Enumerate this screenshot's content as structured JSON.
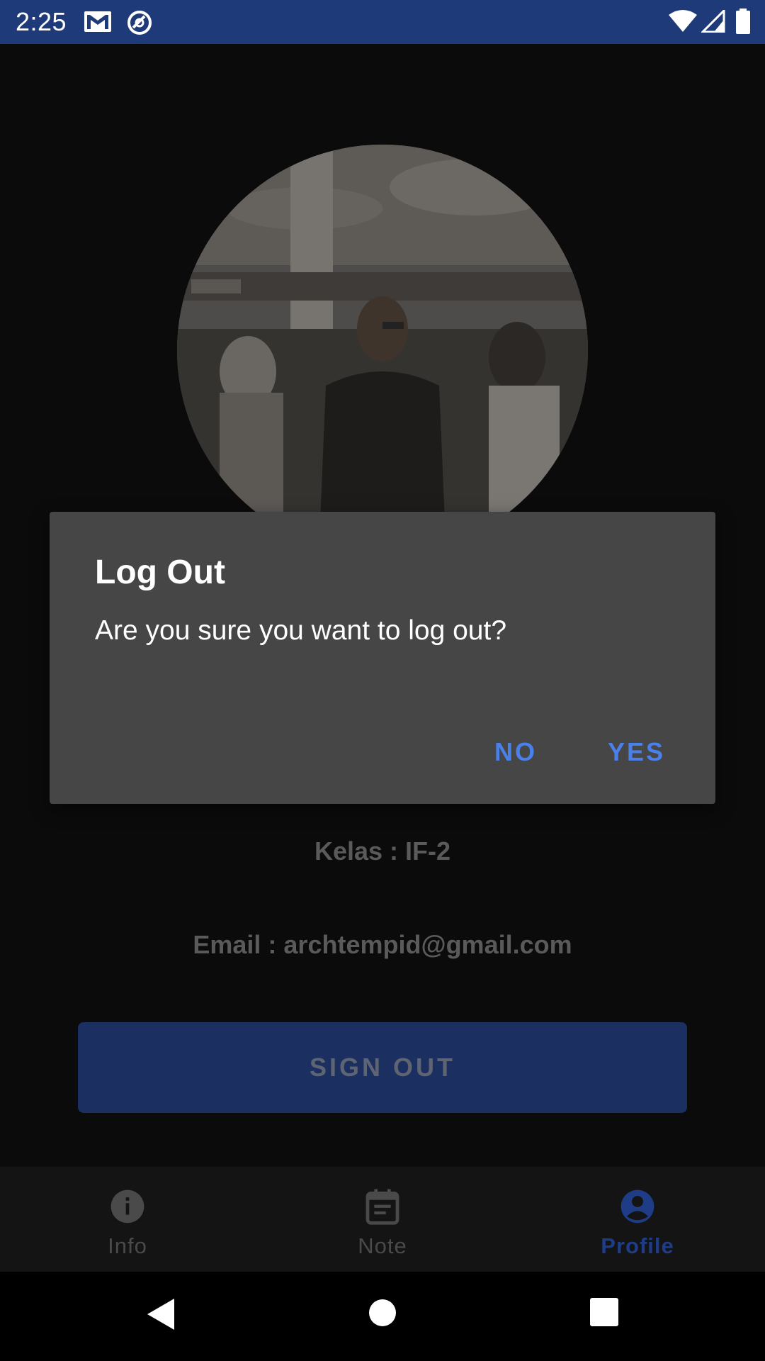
{
  "status_bar": {
    "time": "2:25",
    "icons": [
      "gmail-icon",
      "sync-icon",
      "wifi-icon",
      "signal-icon",
      "battery-icon"
    ]
  },
  "profile": {
    "kelas": "Kelas : IF-2",
    "email": "Email : archtempid@gmail.com",
    "sign_out_label": "SIGN OUT"
  },
  "dialog": {
    "title": "Log Out",
    "message": "Are you sure you want to log out?",
    "no_label": "NO",
    "yes_label": "YES"
  },
  "bottom_nav": {
    "items": [
      {
        "label": "Info",
        "icon": "info-icon",
        "active": false
      },
      {
        "label": "Note",
        "icon": "calendar-icon",
        "active": false
      },
      {
        "label": "Profile",
        "icon": "account-circle-icon",
        "active": true
      }
    ]
  },
  "system_nav": {
    "icons": [
      "back-icon",
      "home-icon",
      "recents-icon"
    ]
  },
  "colors": {
    "status_bar": "#1e3a78",
    "accent": "#4a80ea",
    "dialog_bg": "#464646",
    "sign_out_bg": "#1b2f60",
    "nav_active": "#1e3d86"
  }
}
